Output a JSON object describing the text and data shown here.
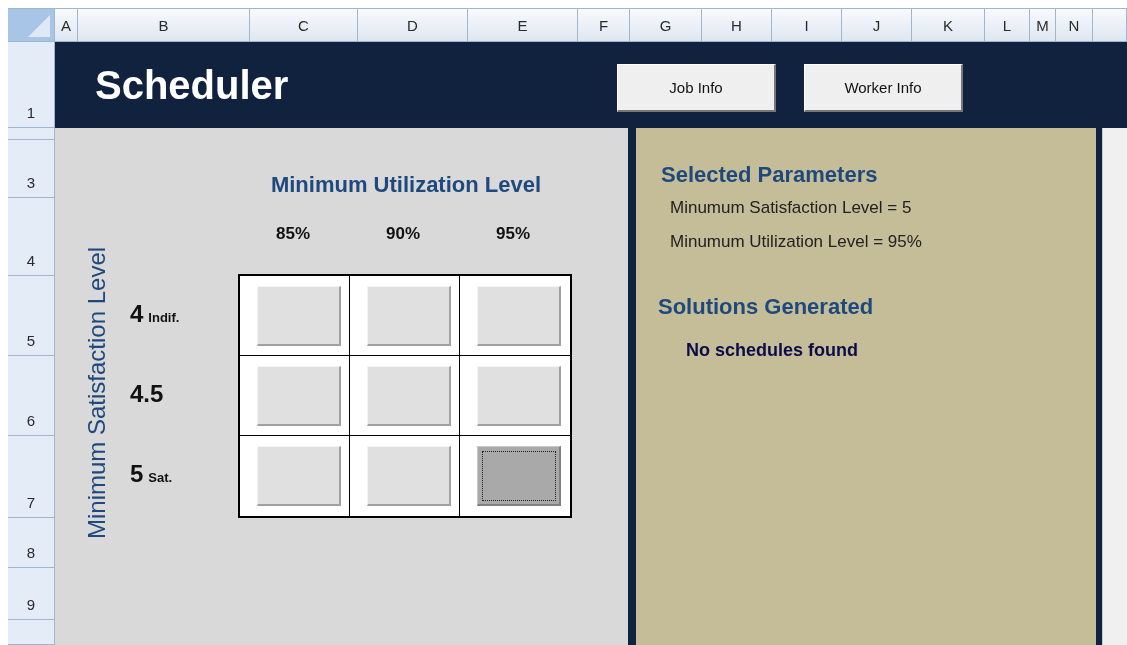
{
  "columns": [
    "A",
    "B",
    "C",
    "D",
    "E",
    "F",
    "G",
    "H",
    "I",
    "J",
    "K",
    "L",
    "M",
    "N"
  ],
  "rows": [
    "1",
    "3",
    "4",
    "5",
    "6",
    "7",
    "8",
    "9"
  ],
  "title": "Scheduler",
  "header_buttons": [
    "Job Info",
    "Worker Info"
  ],
  "matrix": {
    "y_axis_title": "Minimum Satisfaction Level",
    "x_axis_title": "Minimum Utilization Level",
    "columns": [
      "85%",
      "90%",
      "95%"
    ],
    "rows": [
      {
        "value": "4",
        "note": "Indif.",
        "cells": [
          {
            "selected": false
          },
          {
            "selected": false
          },
          {
            "selected": false
          }
        ]
      },
      {
        "value": "4.5",
        "cells": [
          {
            "selected": false
          },
          {
            "selected": false
          },
          {
            "selected": false
          }
        ]
      },
      {
        "value": "5",
        "note": "Sat.",
        "cells": [
          {
            "selected": false
          },
          {
            "selected": false
          },
          {
            "selected": true
          }
        ]
      }
    ]
  },
  "selected_parameters": {
    "heading": "Selected Parameters",
    "lines": [
      "Minumum Satisfaction Level = 5",
      "Minumum Utilization Level = 95%"
    ]
  },
  "solutions": {
    "heading": "Solutions Generated",
    "message": "No schedules found"
  }
}
